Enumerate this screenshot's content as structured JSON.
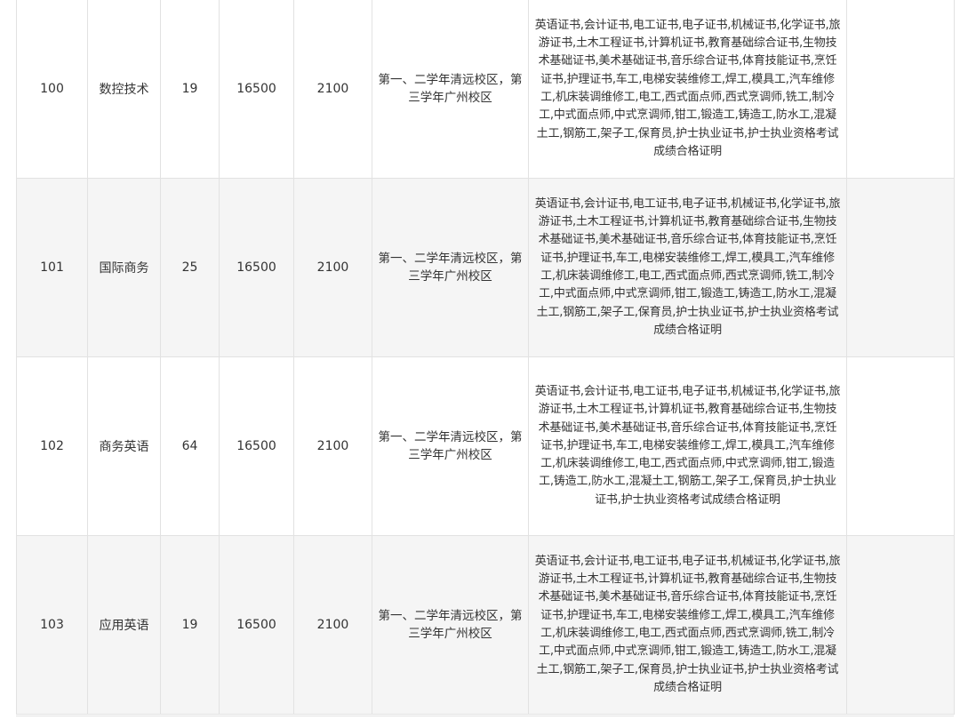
{
  "table": {
    "rows": [
      {
        "code": "100",
        "major": "数控技术",
        "plan": "19",
        "tuition": "16500",
        "accommodation": "2100",
        "campus": "第一、二学年清远校区，第三学年广州校区",
        "certificates": "英语证书,会计证书,电工证书,电子证书,机械证书,化学证书,旅游证书,土木工程证书,计算机证书,教育基础综合证书,生物技术基础证书,美术基础证书,音乐综合证书,体育技能证书,烹饪证书,护理证书,车工,电梯安装维修工,焊工,模具工,汽车维修工,机床装调维修工,电工,西式面点师,西式烹调师,铣工,制冷工,中式面点师,中式烹调师,钳工,锻造工,铸造工,防水工,混凝土工,钢筋工,架子工,保育员,护士执业证书,护士执业资格考试成绩合格证明",
        "remark": ""
      },
      {
        "code": "101",
        "major": "国际商务",
        "plan": "25",
        "tuition": "16500",
        "accommodation": "2100",
        "campus": "第一、二学年清远校区，第三学年广州校区",
        "certificates": "英语证书,会计证书,电工证书,电子证书,机械证书,化学证书,旅游证书,土木工程证书,计算机证书,教育基础综合证书,生物技术基础证书,美术基础证书,音乐综合证书,体育技能证书,烹饪证书,护理证书,车工,电梯安装维修工,焊工,模具工,汽车维修工,机床装调维修工,电工,西式面点师,西式烹调师,铣工,制冷工,中式面点师,中式烹调师,钳工,锻造工,铸造工,防水工,混凝土工,钢筋工,架子工,保育员,护士执业证书,护士执业资格考试成绩合格证明",
        "remark": ""
      },
      {
        "code": "102",
        "major": "商务英语",
        "plan": "64",
        "tuition": "16500",
        "accommodation": "2100",
        "campus": "第一、二学年清远校区，第三学年广州校区",
        "certificates": "英语证书,会计证书,电工证书,电子证书,机械证书,化学证书,旅游证书,土木工程证书,计算机证书,教育基础综合证书,生物技术基础证书,美术基础证书,音乐综合证书,体育技能证书,烹饪证书,护理证书,车工,电梯安装维修工,焊工,模具工,汽车维修工,机床装调维修工,电工,西式面点师,中式烹调师,钳工,锻造工,铸造工,防水工,混凝土工,钢筋工,架子工,保育员,护士执业证书,护士执业资格考试成绩合格证明",
        "remark": ""
      },
      {
        "code": "103",
        "major": "应用英语",
        "plan": "19",
        "tuition": "16500",
        "accommodation": "2100",
        "campus": "第一、二学年清远校区，第三学年广州校区",
        "certificates": "英语证书,会计证书,电工证书,电子证书,机械证书,化学证书,旅游证书,土木工程证书,计算机证书,教育基础综合证书,生物技术基础证书,美术基础证书,音乐综合证书,体育技能证书,烹饪证书,护理证书,车工,电梯安装维修工,焊工,模具工,汽车维修工,机床装调维修工,电工,西式面点师,西式烹调师,铣工,制冷工,中式面点师,中式烹调师,钳工,锻造工,铸造工,防水工,混凝土工,钢筋工,架子工,保育员,护士执业证书,护士执业资格考试成绩合格证明",
        "remark": ""
      }
    ]
  }
}
